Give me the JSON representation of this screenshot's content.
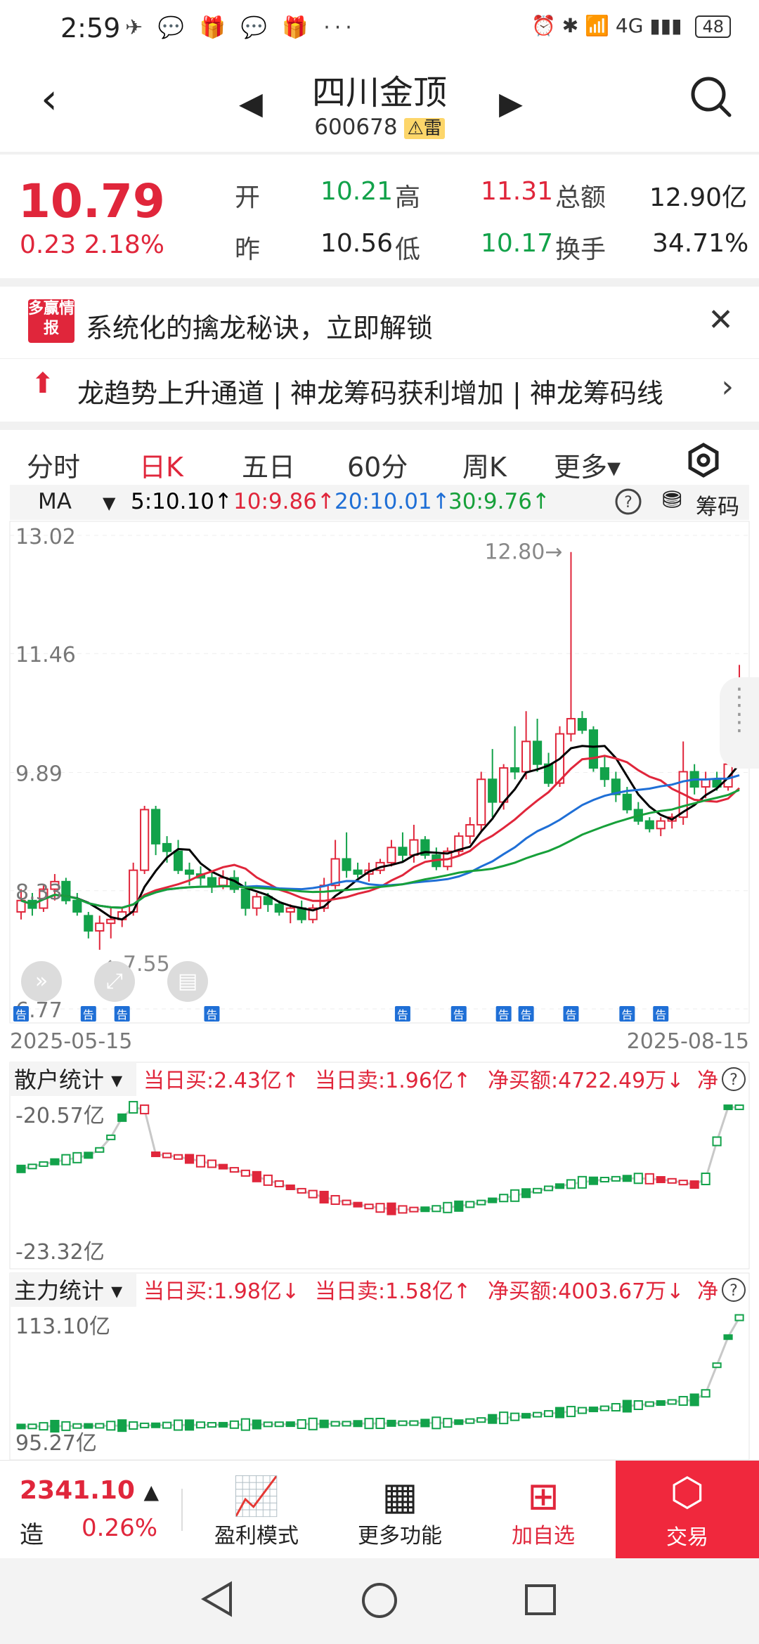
{
  "status": {
    "time": "2:59",
    "icons": "✈ 💬 🎁 💬 🎁 ···",
    "right": "⏰ ✱ 📶 4G ▮▮▮",
    "battery": "48"
  },
  "header": {
    "title": "四川金顶",
    "code": "600678",
    "badge": "⚠雷"
  },
  "quote": {
    "price": "10.79",
    "change": "0.23  2.18%",
    "open_label": "开",
    "open": "10.21",
    "high_label": "高",
    "high": "11.31",
    "amount_label": "总额",
    "amount": "12.90亿",
    "prev_label": "昨",
    "prev": "10.56",
    "low_label": "低",
    "low": "10.17",
    "turnover_label": "换手",
    "turnover": "34.71%"
  },
  "ad": {
    "logo": "多赢情报",
    "text": "系统化的擒龙秘诀，立即解锁"
  },
  "marquee": {
    "text": "龙趋势上升通道 | 神龙筹码获利增加 | 神龙筹码线"
  },
  "tabs": [
    "分时",
    "日K",
    "五日",
    "60分",
    "周K",
    "更多▾"
  ],
  "toolbar": {
    "ma": "MA",
    "ma5": "5:10.10↑",
    "ma10": "10:9.86↑",
    "ma20": "20:10.01↑",
    "ma30": "30:9.76↑",
    "chips": "筹码"
  },
  "chart_data": [
    {
      "type": "candlestick",
      "title": "",
      "y_ticks": [
        "13.02",
        "11.46",
        "9.89",
        "8.33",
        "6.77"
      ],
      "annotations": {
        "high": "12.80",
        "low": "7.55"
      },
      "date_start": "2025-05-15",
      "date_end": "2025-08-15",
      "ylim": [
        6.77,
        13.02
      ],
      "ohlc": [
        [
          8.05,
          8.35,
          7.95,
          8.2
        ],
        [
          8.2,
          8.3,
          8.0,
          8.1
        ],
        [
          8.1,
          8.4,
          8.05,
          8.35
        ],
        [
          8.35,
          8.55,
          8.2,
          8.45
        ],
        [
          8.45,
          8.5,
          8.15,
          8.2
        ],
        [
          8.2,
          8.3,
          8.0,
          8.05
        ],
        [
          8.0,
          8.05,
          7.7,
          7.8
        ],
        [
          7.8,
          8.0,
          7.55,
          7.9
        ],
        [
          7.9,
          8.1,
          7.7,
          7.95
        ],
        [
          7.95,
          8.1,
          7.85,
          8.05
        ],
        [
          8.05,
          8.7,
          8.0,
          8.6
        ],
        [
          8.6,
          9.45,
          8.55,
          9.4
        ],
        [
          9.4,
          9.45,
          8.8,
          8.95
        ],
        [
          8.95,
          9.05,
          8.7,
          8.85
        ],
        [
          8.85,
          9.0,
          8.55,
          8.6
        ],
        [
          8.6,
          8.7,
          8.4,
          8.55
        ],
        [
          8.55,
          8.65,
          8.4,
          8.5
        ],
        [
          8.5,
          8.6,
          8.3,
          8.4
        ],
        [
          8.4,
          8.6,
          8.35,
          8.5
        ],
        [
          8.5,
          8.6,
          8.3,
          8.35
        ],
        [
          8.35,
          8.45,
          8.0,
          8.1
        ],
        [
          8.1,
          8.3,
          8.0,
          8.25
        ],
        [
          8.25,
          8.3,
          8.05,
          8.15
        ],
        [
          8.15,
          8.2,
          8.0,
          8.05
        ],
        [
          8.05,
          8.15,
          7.9,
          8.1
        ],
        [
          8.1,
          8.2,
          7.9,
          7.95
        ],
        [
          7.95,
          8.15,
          7.9,
          8.1
        ],
        [
          8.1,
          8.5,
          8.05,
          8.4
        ],
        [
          8.4,
          9.0,
          8.35,
          8.75
        ],
        [
          8.75,
          9.1,
          8.5,
          8.6
        ],
        [
          8.6,
          8.7,
          8.5,
          8.55
        ],
        [
          8.55,
          8.7,
          8.45,
          8.6
        ],
        [
          8.6,
          8.75,
          8.55,
          8.7
        ],
        [
          8.7,
          9.0,
          8.65,
          8.9
        ],
        [
          8.9,
          9.1,
          8.7,
          8.8
        ],
        [
          8.8,
          9.2,
          8.7,
          9.0
        ],
        [
          9.0,
          9.05,
          8.75,
          8.8
        ],
        [
          8.8,
          8.9,
          8.6,
          8.65
        ],
        [
          8.65,
          8.9,
          8.6,
          8.85
        ],
        [
          8.85,
          9.1,
          8.8,
          9.05
        ],
        [
          9.05,
          9.3,
          8.95,
          9.2
        ],
        [
          9.2,
          9.9,
          9.1,
          9.8
        ],
        [
          9.8,
          10.2,
          9.3,
          9.5
        ],
        [
          9.5,
          10.0,
          9.4,
          9.95
        ],
        [
          9.95,
          10.5,
          9.8,
          9.9
        ],
        [
          9.9,
          10.7,
          9.8,
          10.3
        ],
        [
          10.3,
          10.6,
          9.9,
          10.0
        ],
        [
          10.0,
          10.15,
          9.7,
          9.75
        ],
        [
          9.75,
          10.5,
          9.7,
          10.4
        ],
        [
          10.4,
          12.8,
          10.3,
          10.6
        ],
        [
          10.6,
          10.7,
          10.4,
          10.45
        ],
        [
          10.45,
          10.5,
          9.9,
          9.95
        ],
        [
          9.95,
          10.1,
          9.7,
          9.8
        ],
        [
          9.8,
          9.9,
          9.5,
          9.6
        ],
        [
          9.6,
          9.7,
          9.35,
          9.4
        ],
        [
          9.4,
          9.5,
          9.2,
          9.25
        ],
        [
          9.25,
          9.3,
          9.1,
          9.15
        ],
        [
          9.15,
          9.3,
          9.05,
          9.25
        ],
        [
          9.25,
          9.35,
          9.15,
          9.3
        ],
        [
          9.3,
          10.3,
          9.2,
          9.9
        ],
        [
          9.9,
          10.0,
          9.6,
          9.7
        ],
        [
          9.7,
          9.9,
          9.55,
          9.8
        ],
        [
          9.8,
          9.9,
          9.65,
          9.7
        ],
        [
          9.7,
          10.1,
          9.65,
          10.0
        ],
        [
          10.56,
          11.31,
          10.17,
          10.79
        ]
      ],
      "ma": {
        "ma5": "10.10",
        "ma10": "9.86",
        "ma20": "10.01",
        "ma30": "9.76"
      },
      "marker_label": "告"
    },
    {
      "type": "candlestick",
      "title": "散户统计",
      "summary": {
        "buy": "当日买:2.43亿↑",
        "sell": "当日卖:1.96亿↑",
        "net": "净买额:4722.49万↓",
        "more": "净"
      },
      "y_ticks": [
        "-20.57亿",
        "-23.32亿"
      ]
    },
    {
      "type": "candlestick",
      "title": "主力统计",
      "summary": {
        "buy": "当日买:1.98亿↓",
        "sell": "当日卖:1.58亿↑",
        "net": "净买额:4003.67万↓",
        "more": "净"
      },
      "y_ticks": [
        "113.10亿",
        "95.27亿"
      ]
    }
  ],
  "bottom": {
    "index_value": "2341.10",
    "index_arrow": "▲",
    "index_name": "造",
    "index_pct": "0.26%",
    "btn1": "盈利模式",
    "btn2": "更多功能",
    "btn3": "加自选",
    "trade": "交易"
  },
  "colors": {
    "up": "#e0263b",
    "down": "#12a24a",
    "ma5": "#000000",
    "ma10": "#e0263b",
    "ma20": "#1f6fd6",
    "ma30": "#17a03a"
  }
}
